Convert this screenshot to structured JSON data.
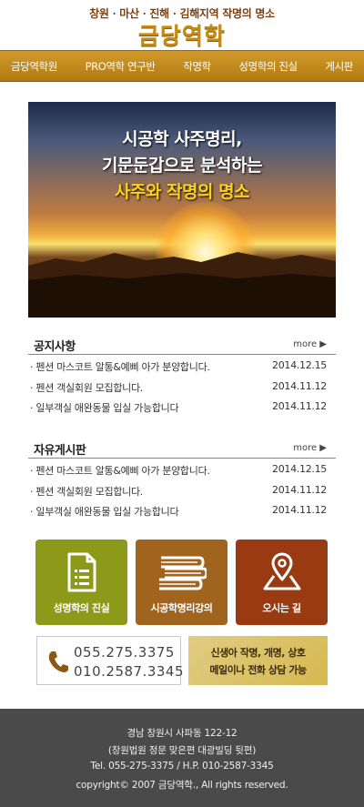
{
  "header": {
    "tagline": "창원 · 마산 · 진해 · 김해지역 작명의 명소",
    "logo": "금당역학"
  },
  "nav": [
    "금당역학원",
    "PRO역학 연구반",
    "작명학",
    "성명학의 진실",
    "게시판"
  ],
  "hero": {
    "line1": "시공학 사주명리,",
    "line2": "기문둔갑으로 분석하는",
    "line3": "사주와 작명의 명소"
  },
  "notice": {
    "title": "공지사항",
    "more": "more ▶",
    "rows": [
      {
        "subject": "· 펜션 마스코트 알통&예삐 아가 분양합니다.",
        "date": "2014.12.15"
      },
      {
        "subject": "· 펜션 객실회원 모집합니다.",
        "date": "2014.11.12"
      },
      {
        "subject": "· 일부객실 애완동물 입실 가능합니다",
        "date": "2014.11.12"
      }
    ]
  },
  "freeboard": {
    "title": "자유게시판",
    "more": "more ▶",
    "rows": [
      {
        "subject": "· 펜션 마스코트 알통&예삐 아가 분양합니다.",
        "date": "2014.12.15"
      },
      {
        "subject": "· 펜션 객실회원 모집합니다.",
        "date": "2014.11.12"
      },
      {
        "subject": "· 일부객실 애완동물 입실 가능합니다",
        "date": "2014.11.12"
      }
    ]
  },
  "tiles": [
    {
      "label": "성명학의 진실",
      "icon": "document-list-icon",
      "color": "#8c9a1a"
    },
    {
      "label": "시공학명리강의",
      "icon": "books-icon",
      "color": "#a0641e"
    },
    {
      "label": "오시는 길",
      "icon": "map-pin-icon",
      "color": "#9a3a12"
    }
  ],
  "contact": {
    "phone1": "055.275.3375",
    "phone2": "010.2587.3345",
    "consult1": "신생아 작명, 개명, 상호",
    "consult2": "메일이나 전화 상담 가능"
  },
  "footer": {
    "line1": "경남 창원시 사파동 122-12",
    "line2": "(창원법원 정문 맞은편 대광빌딩 뒷편)",
    "line3": "Tel. 055-275-3375 / H.P. 010-2587-3345",
    "line4": "copyright© 2007 금당역학., All rights reserved."
  }
}
